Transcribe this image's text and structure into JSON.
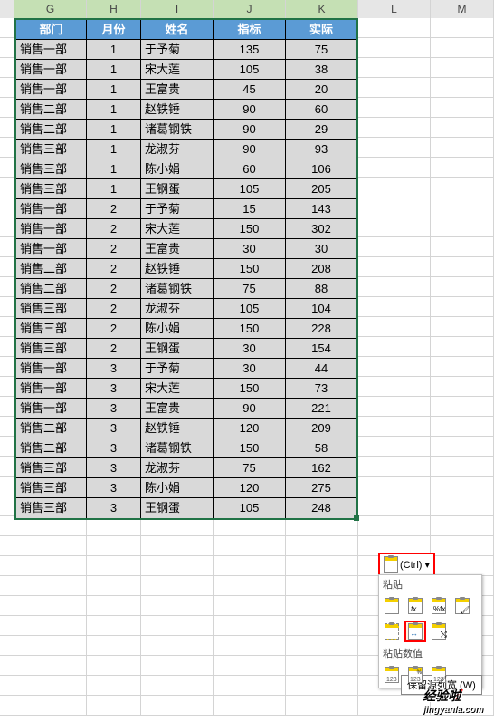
{
  "columns": [
    "G",
    "H",
    "I",
    "J",
    "K",
    "L",
    "M"
  ],
  "headers": [
    "部门",
    "月份",
    "姓名",
    "指标",
    "实际"
  ],
  "rows": [
    [
      "销售一部",
      "1",
      "于予菊",
      "135",
      "75"
    ],
    [
      "销售一部",
      "1",
      "宋大莲",
      "105",
      "38"
    ],
    [
      "销售一部",
      "1",
      "王富贵",
      "45",
      "20"
    ],
    [
      "销售二部",
      "1",
      "赵铁锤",
      "90",
      "60"
    ],
    [
      "销售二部",
      "1",
      "诸葛钢铁",
      "90",
      "29"
    ],
    [
      "销售三部",
      "1",
      "龙淑芬",
      "90",
      "93"
    ],
    [
      "销售三部",
      "1",
      "陈小娟",
      "60",
      "106"
    ],
    [
      "销售三部",
      "1",
      "王钢蛋",
      "105",
      "205"
    ],
    [
      "销售一部",
      "2",
      "于予菊",
      "15",
      "143"
    ],
    [
      "销售一部",
      "2",
      "宋大莲",
      "150",
      "302"
    ],
    [
      "销售一部",
      "2",
      "王富贵",
      "30",
      "30"
    ],
    [
      "销售二部",
      "2",
      "赵铁锤",
      "150",
      "208"
    ],
    [
      "销售二部",
      "2",
      "诸葛钢铁",
      "75",
      "88"
    ],
    [
      "销售三部",
      "2",
      "龙淑芬",
      "105",
      "104"
    ],
    [
      "销售三部",
      "2",
      "陈小娟",
      "150",
      "228"
    ],
    [
      "销售三部",
      "2",
      "王钢蛋",
      "30",
      "154"
    ],
    [
      "销售一部",
      "3",
      "于予菊",
      "30",
      "44"
    ],
    [
      "销售一部",
      "3",
      "宋大莲",
      "150",
      "73"
    ],
    [
      "销售一部",
      "3",
      "王富贵",
      "90",
      "221"
    ],
    [
      "销售二部",
      "3",
      "赵铁锤",
      "120",
      "209"
    ],
    [
      "销售二部",
      "3",
      "诸葛钢铁",
      "150",
      "58"
    ],
    [
      "销售三部",
      "3",
      "龙淑芬",
      "75",
      "162"
    ],
    [
      "销售三部",
      "3",
      "陈小娟",
      "120",
      "275"
    ],
    [
      "销售三部",
      "3",
      "王钢蛋",
      "105",
      "248"
    ]
  ],
  "paste_button_label": "(Ctrl) ▾",
  "paste_section1": "粘贴",
  "paste_section2": "粘贴数值",
  "tooltip_text": "保留源列宽 (W)",
  "watermark_main": "经验啦",
  "watermark_sub": "jingyanla.com",
  "checkmark": "✓"
}
